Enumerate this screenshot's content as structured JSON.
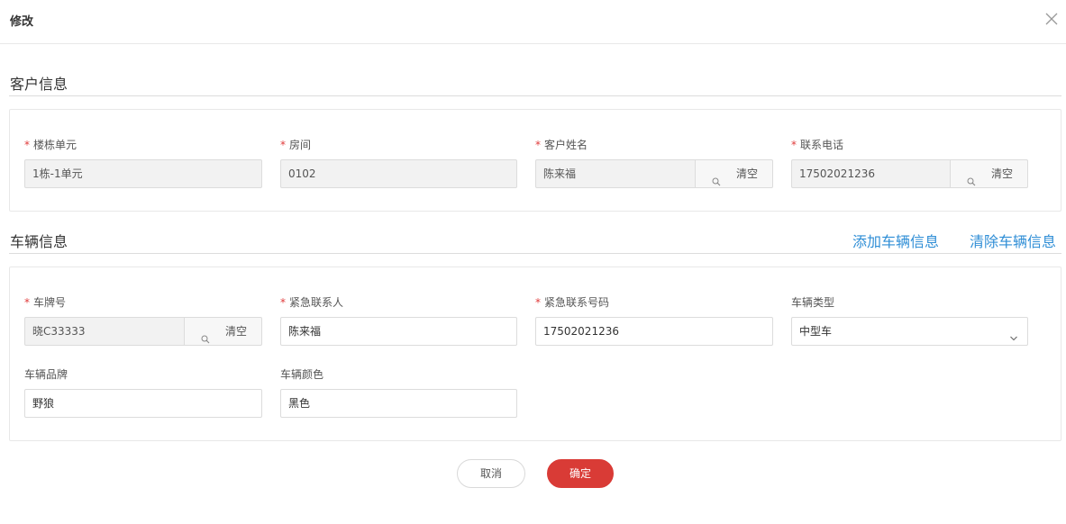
{
  "dialog": {
    "title": "修改"
  },
  "customer_section": {
    "title": "客户信息",
    "fields": {
      "building": {
        "label": "楼栋单元",
        "value": "1栋-1单元"
      },
      "room": {
        "label": "房间",
        "value": "0102"
      },
      "name": {
        "label": "客户姓名",
        "value": "陈来福",
        "clear_label": "清空"
      },
      "phone": {
        "label": "联系电话",
        "value": "17502021236",
        "clear_label": "清空"
      }
    }
  },
  "vehicle_section": {
    "title": "车辆信息",
    "add_link": "添加车辆信息",
    "clear_link": "清除车辆信息",
    "fields": {
      "plate": {
        "label": "车牌号",
        "value": "晓C33333",
        "clear_label": "清空"
      },
      "contact": {
        "label": "紧急联系人",
        "value": "陈来福"
      },
      "contact_phone": {
        "label": "紧急联系号码",
        "value": "17502021236"
      },
      "type": {
        "label": "车辆类型",
        "value": "中型车"
      },
      "brand": {
        "label": "车辆品牌",
        "value": "野狼"
      },
      "color": {
        "label": "车辆颜色",
        "value": "黑色"
      }
    }
  },
  "footer": {
    "cancel_label": "取消",
    "confirm_label": "确定"
  },
  "colors": {
    "accent_link": "#2f8ed6",
    "primary_button": "#d93b36",
    "required_star": "#e03b3b"
  },
  "icons": {
    "close": "close-icon",
    "search": "search-icon",
    "dropdown": "chevron-down-icon"
  }
}
